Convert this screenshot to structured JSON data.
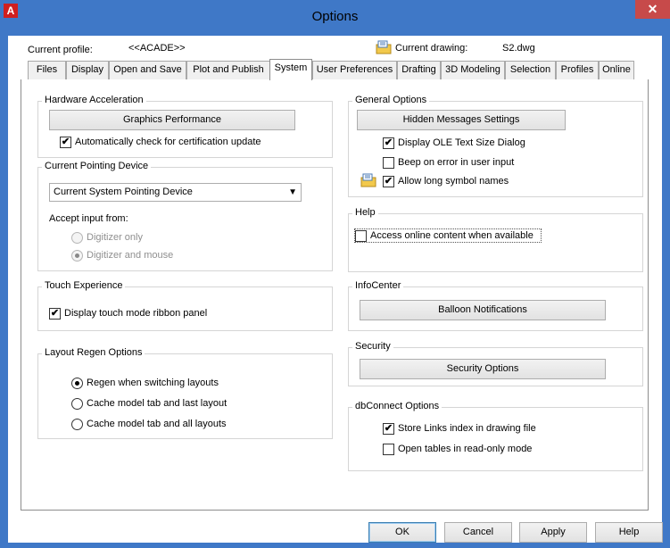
{
  "window": {
    "app_icon_letter": "A",
    "title": "Options",
    "close_glyph": "✕"
  },
  "profile": {
    "current_profile_label": "Current profile:",
    "current_profile_value": "<<ACADE>>",
    "current_drawing_label": "Current drawing:",
    "current_drawing_value": "S2.dwg"
  },
  "tabs": [
    {
      "label": "Files"
    },
    {
      "label": "Display"
    },
    {
      "label": "Open and Save"
    },
    {
      "label": "Plot and Publish"
    },
    {
      "label": "System",
      "active": true
    },
    {
      "label": "User Preferences"
    },
    {
      "label": "Drafting"
    },
    {
      "label": "3D Modeling"
    },
    {
      "label": "Selection"
    },
    {
      "label": "Profiles"
    },
    {
      "label": "Online"
    }
  ],
  "hardware": {
    "title": "Hardware Acceleration",
    "graphics_button": "Graphics Performance",
    "auto_check_label": "Automatically check for certification update",
    "auto_check_checked": true
  },
  "pointing": {
    "title": "Current Pointing Device",
    "selected": "Current System Pointing Device",
    "accept_label": "Accept input from:",
    "digitizer_only": "Digitizer only",
    "digitizer_and_mouse": "Digitizer and mouse"
  },
  "touch": {
    "title": "Touch Experience",
    "ribbon_label": "Display touch mode ribbon panel",
    "ribbon_checked": true
  },
  "layout_regen": {
    "title": "Layout Regen Options",
    "opt_regen": "Regen when switching layouts",
    "opt_cache_last": "Cache model tab and last layout",
    "opt_cache_all": "Cache model tab and all layouts"
  },
  "general": {
    "title": "General Options",
    "hidden_messages_button": "Hidden Messages Settings",
    "ole_label": "Display OLE Text Size Dialog",
    "ole_checked": true,
    "beep_label": "Beep on error in user input",
    "beep_checked": false,
    "long_names_label": "Allow long symbol names",
    "long_names_checked": true
  },
  "help": {
    "title": "Help",
    "online_label": "Access online content when available",
    "online_checked": false
  },
  "infocenter": {
    "title": "InfoCenter",
    "balloon_button": "Balloon Notifications"
  },
  "security": {
    "title": "Security",
    "options_button": "Security Options"
  },
  "dbconnect": {
    "title": "dbConnect Options",
    "store_links_label": "Store Links index in drawing file",
    "store_links_checked": true,
    "readonly_label": "Open tables in read-only mode",
    "readonly_checked": false
  },
  "footer": {
    "ok": "OK",
    "cancel": "Cancel",
    "apply": "Apply",
    "help": "Help"
  },
  "colors": {
    "frame": "#3f78c7",
    "close": "#c74a4a",
    "app_icon": "#d01f1f"
  },
  "icons": {
    "drawing_icon": "drawing-file-icon",
    "symbol_icon": "drawing-file-icon"
  }
}
